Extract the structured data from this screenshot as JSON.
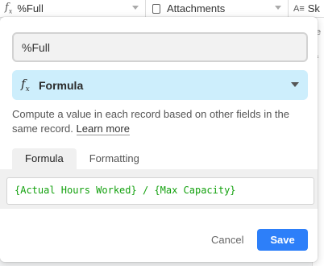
{
  "grid_header": {
    "col1": {
      "icon": "formula-icon",
      "label": "%Full"
    },
    "col2": {
      "icon": "attachment-icon",
      "label": "Attachments"
    },
    "col3": {
      "icon": "text-icon",
      "label": "Sk"
    }
  },
  "field_editor": {
    "field_name": "%Full",
    "field_type": {
      "icon": "formula-icon",
      "label": "Formula"
    },
    "description": "Compute a value in each record based on other fields in the same record.",
    "learn_more": "Learn more",
    "tabs": [
      {
        "label": "Formula",
        "active": true
      },
      {
        "label": "Formatting",
        "active": false
      }
    ],
    "formula": "{Actual Hours Worked} / {Max Capacity}",
    "cancel_label": "Cancel",
    "save_label": "Save"
  },
  "colors": {
    "accent": "#2d7ff9",
    "type_select_bg": "#cdeefc",
    "formula_text": "#13a10e"
  }
}
